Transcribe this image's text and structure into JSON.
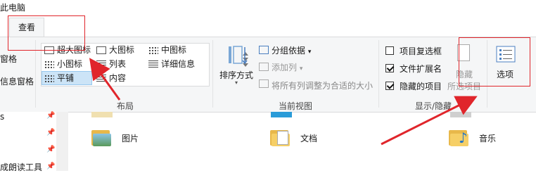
{
  "window": {
    "title": "此电脑"
  },
  "tabs": {
    "view": "查看"
  },
  "left_panes": {
    "nav_pane_partial": "窗格",
    "details_pane_partial": "信息窗格"
  },
  "layout": {
    "group_label": "布局",
    "items": {
      "extra_large": "超大图标",
      "large": "大图标",
      "medium": "中图标",
      "small": "小图标",
      "list": "列表",
      "details": "详细信息",
      "tiles": "平铺",
      "content": "内容"
    },
    "selected": "tiles"
  },
  "current_view": {
    "group_label": "当前视图",
    "sort_by": "排序方式",
    "group_by": "分组依据",
    "add_column": "添加列",
    "fit_columns": "将所有列调整为合适的大小"
  },
  "show_hide": {
    "group_label": "显示/隐藏",
    "item_checkboxes": {
      "label": "项目复选框",
      "checked": false
    },
    "file_extensions": {
      "label": "文件扩展名",
      "checked": true
    },
    "hidden_items": {
      "label": "隐藏的项目",
      "checked": true
    },
    "hide_selected_line1": "隐藏",
    "hide_selected_line2": "所选项目"
  },
  "options": {
    "label": "选项"
  },
  "nav_items": [
    "s",
    "",
    "",
    "成朗读工具"
  ],
  "folders": [
    {
      "name": "图片",
      "icon": "pictures-folder-icon"
    },
    {
      "name": "文档",
      "icon": "documents-folder-icon"
    },
    {
      "name": "音乐",
      "icon": "music-folder-icon"
    }
  ],
  "colors": {
    "annotation": "#e0252b",
    "selection": "#cce4f7",
    "ribbon_bg": "#f5f6f7"
  }
}
